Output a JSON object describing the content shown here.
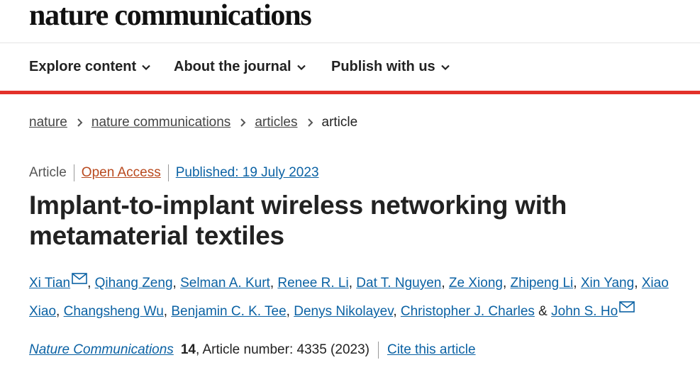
{
  "header": {
    "logo": "nature communications"
  },
  "nav": [
    {
      "label": "Explore content"
    },
    {
      "label": "About the journal"
    },
    {
      "label": "Publish with us"
    }
  ],
  "breadcrumb": [
    "nature",
    "nature communications",
    "articles",
    "article"
  ],
  "meta": {
    "type": "Article",
    "access": "Open Access",
    "published": "Published: 19 July 2023"
  },
  "article": {
    "title": "Implant-to-implant wireless networking with metamaterial textiles"
  },
  "authors": [
    "Xi Tian",
    "Qihang Zeng",
    "Selman A. Kurt",
    "Renee R. Li",
    "Dat T. Nguyen",
    "Ze Xiong",
    "Zhipeng Li",
    "Xin Yang",
    "Xiao Xiao",
    "Changsheng Wu",
    "Benjamin C. K. Tee",
    "Denys Nikolayev",
    "Christopher J. Charles",
    "John S. Ho"
  ],
  "citation": {
    "journal": "Nature Communications",
    "volume": "14",
    "details": ", Article number: 4335 (2023)",
    "cite_label": "Cite this article"
  },
  "colors": {
    "accent_bar": "#e3312a",
    "link": "#0b62a4",
    "open_access": "#b94a1f"
  }
}
